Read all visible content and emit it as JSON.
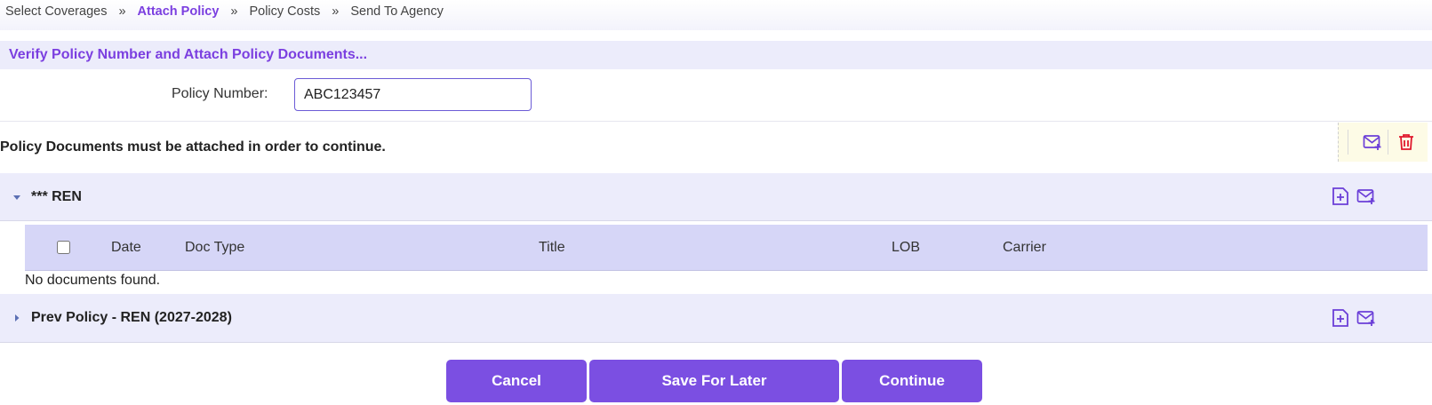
{
  "breadcrumb": {
    "items": [
      "Select Coverages",
      "Attach Policy",
      "Policy Costs",
      "Send To Agency"
    ],
    "separator": "»",
    "active_index": 1
  },
  "section": {
    "title": "Verify Policy Number and Attach Policy Documents..."
  },
  "policy": {
    "label": "Policy Number:",
    "value": "ABC123457"
  },
  "notice": {
    "text": "Policy Documents must be attached in order to continue."
  },
  "top_actions": {
    "icons": [
      "email-add-icon",
      "trash-icon"
    ]
  },
  "groups": [
    {
      "title": "*** REN",
      "expanded": true,
      "icons": [
        "add-document-icon",
        "email-add-icon"
      ]
    },
    {
      "title": "Prev Policy - REN (2027-2028)",
      "expanded": false,
      "icons": [
        "add-document-icon",
        "email-add-icon"
      ]
    }
  ],
  "table": {
    "columns": [
      "Date",
      "Doc Type",
      "Title",
      "LOB",
      "Carrier"
    ],
    "select_all_checked": false,
    "empty_text": "No documents found."
  },
  "buttons": {
    "cancel": "Cancel",
    "save": "Save For Later",
    "continue": "Continue"
  },
  "colors": {
    "accent": "#7b4fe2",
    "active_crumb": "#7b3fe0",
    "section_bg": "#ececfb",
    "table_header_bg": "#d6d6f7",
    "delete_icon": "#e0182d"
  }
}
